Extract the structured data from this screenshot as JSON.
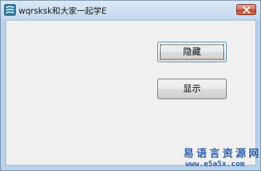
{
  "window": {
    "title": "wqrsksk和大家一起学E"
  },
  "buttons": {
    "hide_label": "隐藏",
    "show_label": "显示"
  },
  "watermark": {
    "site_name": "易语言资源网",
    "site_url": "www.e5a5x.com"
  },
  "icons": {
    "app": "app-window-icon",
    "close": "close-icon"
  },
  "colors": {
    "close_button": "#c4452a",
    "watermark": "#2a5db0",
    "client_background": "#f0f0f0"
  }
}
